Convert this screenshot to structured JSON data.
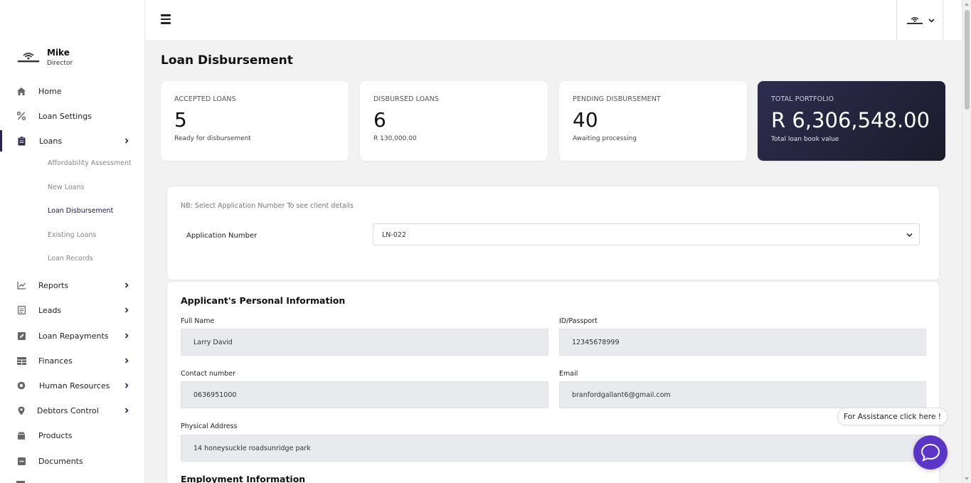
{
  "user": {
    "name": "Mike",
    "role": "Director"
  },
  "sidebar": {
    "items": [
      {
        "label": "Home",
        "icon": "home-icon"
      },
      {
        "label": "Loan Settings",
        "icon": "percent-icon"
      },
      {
        "label": "Loans",
        "icon": "clipboard-icon"
      },
      {
        "label": "Reports",
        "icon": "chart-line-icon"
      },
      {
        "label": "Leads",
        "icon": "document-icon"
      },
      {
        "label": "Loan Repayments",
        "icon": "edit-icon"
      },
      {
        "label": "Finances",
        "icon": "table-icon"
      },
      {
        "label": "Human Resources",
        "icon": "circle-icon"
      },
      {
        "label": "Debtors Control",
        "icon": "map-pin-icon"
      },
      {
        "label": "Products",
        "icon": "box-icon"
      },
      {
        "label": "Documents",
        "icon": "minus-square-icon"
      }
    ],
    "loans_sub": [
      {
        "label": "Affordability Assessment"
      },
      {
        "label": "New Loans"
      },
      {
        "label": "Loan Disbursement"
      },
      {
        "label": "Existing Loans"
      },
      {
        "label": "Loan Records"
      }
    ]
  },
  "page": {
    "title": "Loan Disbursement"
  },
  "stats": [
    {
      "label": "ACCEPTED LOANS",
      "value": "5",
      "sub": "Ready for disbursement"
    },
    {
      "label": "DISBURSED LOANS",
      "value": "6",
      "sub": "R 130,000.00"
    },
    {
      "label": "PENDING DISBURSEMENT",
      "value": "40",
      "sub": "Awaiting processing"
    },
    {
      "label": "TOTAL PORTFOLIO",
      "value": "R 6,306,548.00",
      "sub": "Total loan book value"
    }
  ],
  "selector": {
    "note": "NB: Select Application Number To see client details",
    "label": "Application Number",
    "value": "LN-022"
  },
  "personal": {
    "title": "Applicant's Personal Information",
    "full_name_label": "Full Name",
    "full_name": "Larry David",
    "id_label": "ID/Passport",
    "id": "12345678999",
    "contact_label": "Contact number",
    "contact": "0636951000",
    "email_label": "Email",
    "email": "branfordgallant6@gmail.com",
    "address_label": "Physical Address",
    "address": "14 honeysuckle roadsunridge park"
  },
  "employment": {
    "title": "Employment Information"
  },
  "assist": {
    "label": "For Assistance click here !"
  },
  "colors": {
    "accent": "#2c2450",
    "chat": "#5b35c8",
    "dark_card": "#25243a"
  }
}
